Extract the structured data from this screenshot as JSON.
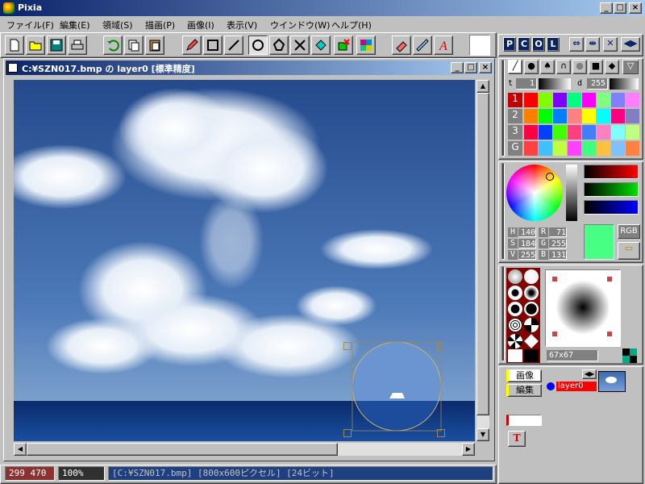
{
  "app": {
    "title": "Pixia",
    "window_buttons": [
      "_",
      "□",
      "×"
    ]
  },
  "menu": [
    "ファイル(F)",
    "編集(E)",
    "領域(S)",
    "描画(P)",
    "画像(I)",
    "表示(V)",
    "ウインドウ(W)",
    "ヘルプ(H)"
  ],
  "toolbar_icons": [
    "new-icon",
    "open-icon",
    "save-icon",
    "print-icon",
    "undo-icon",
    "copy-icon",
    "paste-icon",
    "pen-icon",
    "rect-icon",
    "line-icon",
    "circle-icon",
    "lasso-icon",
    "cross-icon",
    "fill-icon",
    "eraser-icon",
    "mosaic-icon",
    "stamp-icon",
    "ruler-icon",
    "text-icon"
  ],
  "image_window": {
    "title": "C:¥SZN017.bmp の layer0 [標準精度]"
  },
  "mode_buttons": [
    "P",
    "C",
    "O",
    "L"
  ],
  "status": {
    "coords": "299 470",
    "zoom": "100%",
    "info": "[C:¥SZN017.bmp] [800x600ピクセル] [24ビット]"
  },
  "palette": {
    "t_label": "t",
    "t_value": "1",
    "d_label": "d",
    "d_value": "255",
    "rows": [
      "1",
      "2",
      "3",
      "G"
    ],
    "colors": [
      [
        "#ff0000",
        "#80ff00",
        "#8000ff",
        "#00ff80",
        "#ff00ff",
        "#80ff80",
        "#8080ff",
        "#ff80ff"
      ],
      [
        "#ff8000",
        "#00ff00",
        "#0080ff",
        "#ff8080",
        "#ffff00",
        "#00ffff",
        "#ff0080",
        "#8080c0"
      ],
      [
        "#ff0040",
        "#0040ff",
        "#40ff00",
        "#ff4080",
        "#4080ff",
        "#ff80c0",
        "#80ffff",
        "#c0ff80"
      ],
      [
        "#ff4040",
        "#40c0ff",
        "#c0ff40",
        "#ff40ff",
        "#40ff80",
        "#ffc040",
        "#80c0ff",
        "#ff8040"
      ]
    ]
  },
  "color_picker": {
    "H": "140",
    "S": "184",
    "V": "255",
    "R": "71",
    "G": "255",
    "B": "131",
    "current": "#47ff83",
    "mode": "RGB"
  },
  "brush": {
    "size": "67x67"
  },
  "layers": {
    "tab_image": "画像",
    "tab_edit": "編集",
    "layer_name": "layer0"
  }
}
